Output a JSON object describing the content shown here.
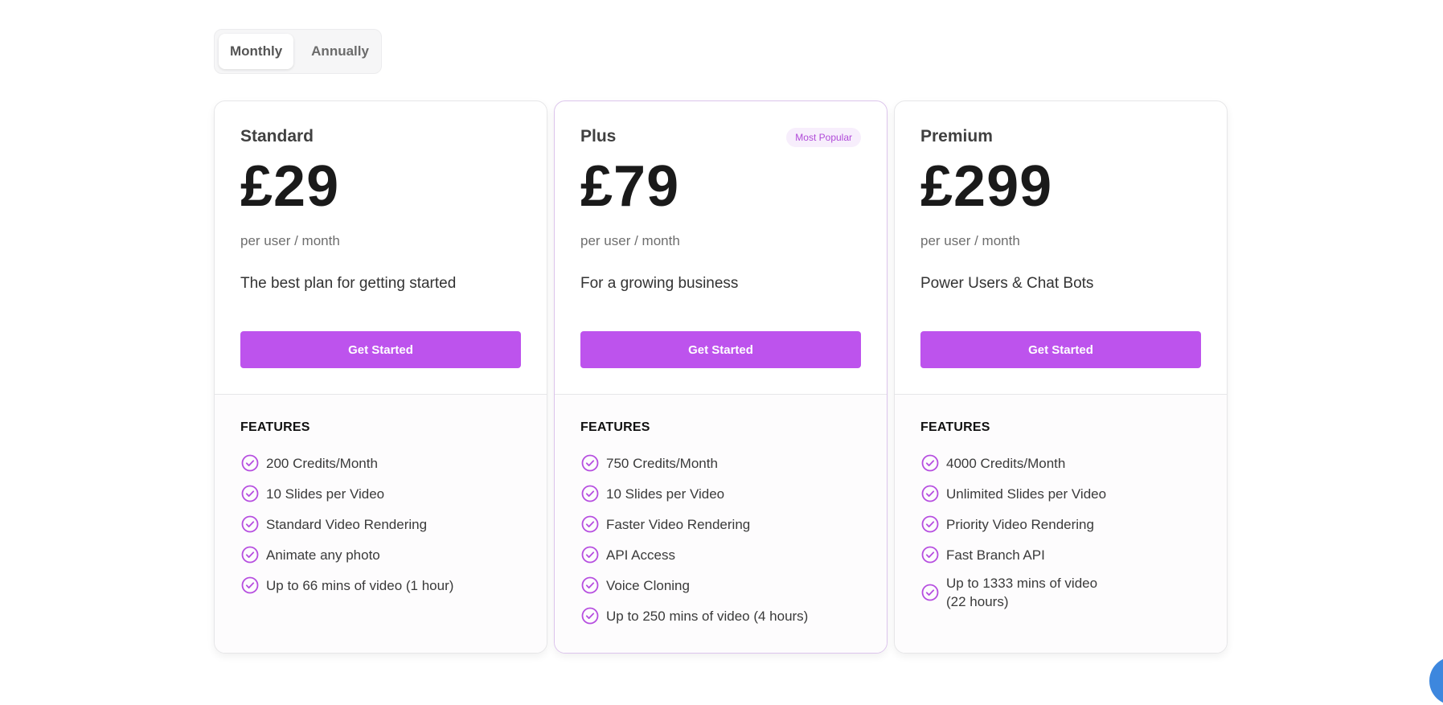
{
  "billing_toggle": {
    "options": [
      "Monthly",
      "Annually"
    ],
    "selected": "Monthly"
  },
  "plans": [
    {
      "name": "Standard",
      "badge": "",
      "price": "£29",
      "period": "per user / month",
      "description": "The best plan for getting started",
      "cta_label": "Get Started",
      "features_title": "FEATURES",
      "features": [
        "200 Credits/Month",
        "10 Slides per Video",
        "Standard Video Rendering",
        "Animate any photo",
        "Up to 66 mins of video (1 hour)"
      ]
    },
    {
      "name": "Plus",
      "badge": "Most Popular",
      "price": "£79",
      "period": "per user / month",
      "description": "For a growing business",
      "cta_label": "Get Started",
      "features_title": "FEATURES",
      "features": [
        "750 Credits/Month",
        "10 Slides per Video",
        "Faster Video Rendering",
        "API Access",
        "Voice Cloning",
        "Up to 250 mins of video (4 hours)"
      ]
    },
    {
      "name": "Premium",
      "badge": "",
      "price": "£299",
      "period": "per user / month",
      "description": "Power Users & Chat Bots",
      "cta_label": "Get Started",
      "features_title": "FEATURES",
      "features": [
        "4000 Credits/Month",
        "Unlimited Slides per Video",
        "Priority Video Rendering",
        "Fast Branch API",
        "Up to 1333 mins of video (22 hours)"
      ]
    }
  ],
  "colors": {
    "accent": "#bd53ed",
    "badge_bg": "#f7eefc",
    "badge_text": "#b04ad8",
    "check": "#b64ee0",
    "chat_bubble": "#3d87de"
  },
  "icons": {
    "feature": "check-circle-icon",
    "chat": "chat-bubble-icon"
  }
}
